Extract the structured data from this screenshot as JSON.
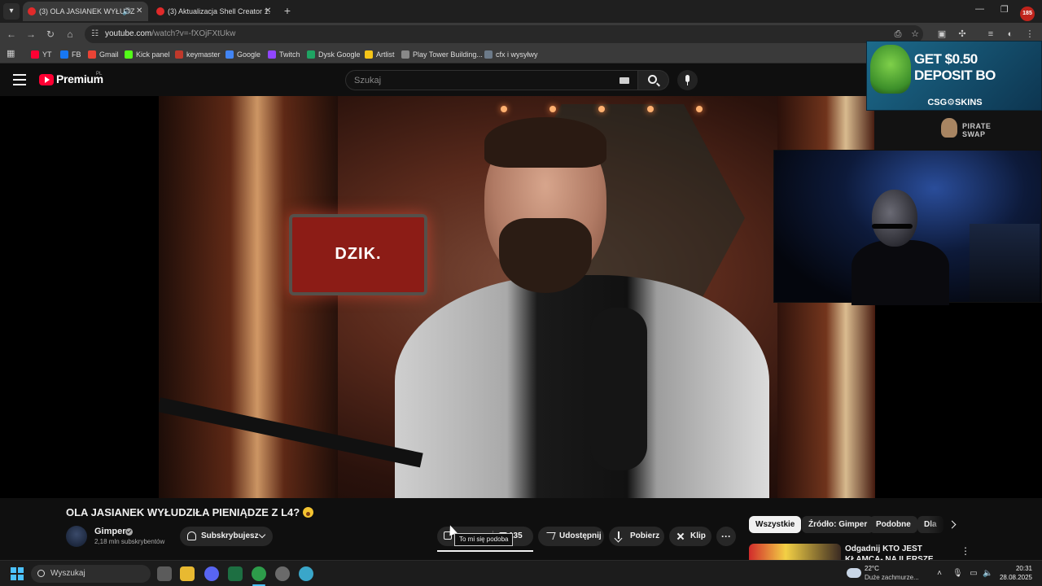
{
  "browser": {
    "tabs": [
      {
        "title": "(3) OLA JASIANEK WYŁUDZ",
        "active": true,
        "audio": true
      },
      {
        "title": "(3) Aktualizacja Shell Creator 1.",
        "active": false,
        "audio": false
      }
    ],
    "tab_close_glyph": "✕",
    "new_tab_glyph": "+",
    "profile_badge": "185",
    "url_host": "youtube.com",
    "url_path": "/watch?v=-fXOjFXtUkw",
    "window_controls": [
      "—",
      "❐",
      "✕"
    ]
  },
  "bookmarks": [
    {
      "label": "YT",
      "icon": "youtube-icon",
      "color": "#ff0033"
    },
    {
      "label": "FB",
      "icon": "facebook-icon",
      "color": "#1877f2"
    },
    {
      "label": "Gmail",
      "icon": "gmail-icon",
      "color": "#ea4335"
    },
    {
      "label": "Kick panel",
      "icon": "kick-icon",
      "color": "#53fc18"
    },
    {
      "label": "keymaster",
      "icon": "keymaster-icon",
      "color": "#c0392b"
    },
    {
      "label": "Google",
      "icon": "google-icon",
      "color": "#4285f4"
    },
    {
      "label": "Twitch",
      "icon": "twitch-icon",
      "color": "#9146ff"
    },
    {
      "label": "Dysk Google",
      "icon": "drive-icon",
      "color": "#1fa463"
    },
    {
      "label": "Artlist",
      "icon": "artlist-icon",
      "color": "#f5c518"
    },
    {
      "label": "Play Tower Building...",
      "icon": "game-icon",
      "color": "#888888"
    },
    {
      "label": "cfx i wysyłwy",
      "icon": "image-icon",
      "color": "#6c7a89"
    }
  ],
  "youtube": {
    "brand": "Premium",
    "region": "PL",
    "search_placeholder": "Szukaj",
    "accent": "#ff0033"
  },
  "overlay": {
    "csgo_line1": "GET $0.50",
    "csgo_line2": "DEPOSIT BO",
    "csgo_brand": "CSG⚙SKINS",
    "pirate_line1": "PIRATE",
    "pirate_line2": "SWAP"
  },
  "video": {
    "sign_text": "DZIK.",
    "title": "OLA JASIANEK WYŁUDZIŁA PIENIĄDZE Z L4?",
    "channel": "Gimper",
    "subscribers": "2,18 mln subskrybentów",
    "subscribe_label": "Subskrybujesz",
    "like_count": "135",
    "like_tooltip": "To mi się podoba",
    "share_label": "Udostępnij",
    "download_label": "Pobierz",
    "clip_label": "Klip",
    "more_glyph": "···"
  },
  "chips": [
    "Wszystkie",
    "Źródło: Gimper",
    "Podobne",
    "Dla"
  ],
  "recommendation": {
    "title": "Odgadnij KTO JEST KŁAMCĄ- NA ILERSZE MOMENTY FAME",
    "more_glyph": "⋮"
  },
  "taskbar": {
    "search_placeholder": "Wyszukaj",
    "weather_temp": "22°C",
    "weather_desc": "Duże zachmurze...",
    "time": "20:31",
    "date": "28.08.2025",
    "accent": "#4cc2ff"
  }
}
